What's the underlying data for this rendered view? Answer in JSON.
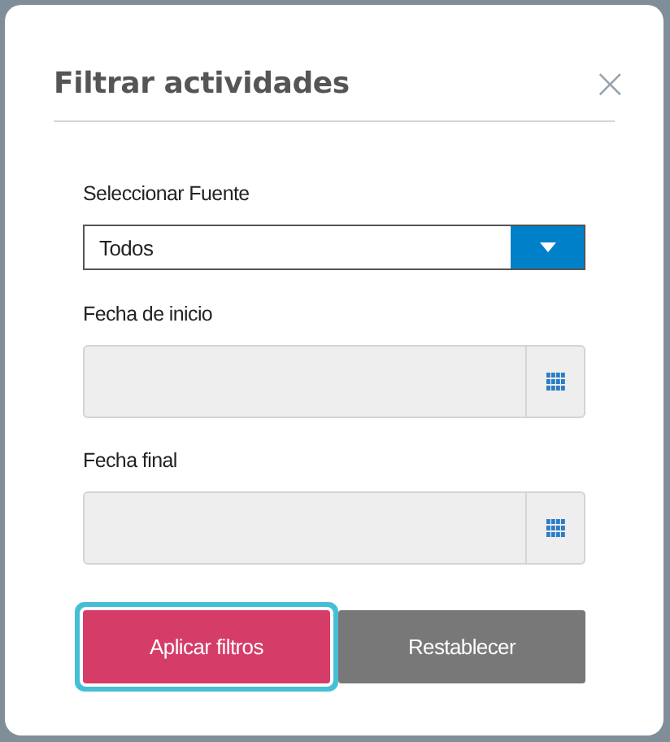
{
  "dialog": {
    "title": "Filtrar actividades",
    "close": "×"
  },
  "source": {
    "label": "Seleccionar Fuente",
    "value": "Todos"
  },
  "dates": [
    {
      "label": "Fecha de inicio"
    },
    {
      "label": "Fecha final"
    }
  ],
  "buttons": [
    {
      "label": "Aplicar filtros",
      "kind": "primary",
      "focused": true
    },
    {
      "label": "Restablecer",
      "kind": "secondary",
      "focused": false
    }
  ]
}
